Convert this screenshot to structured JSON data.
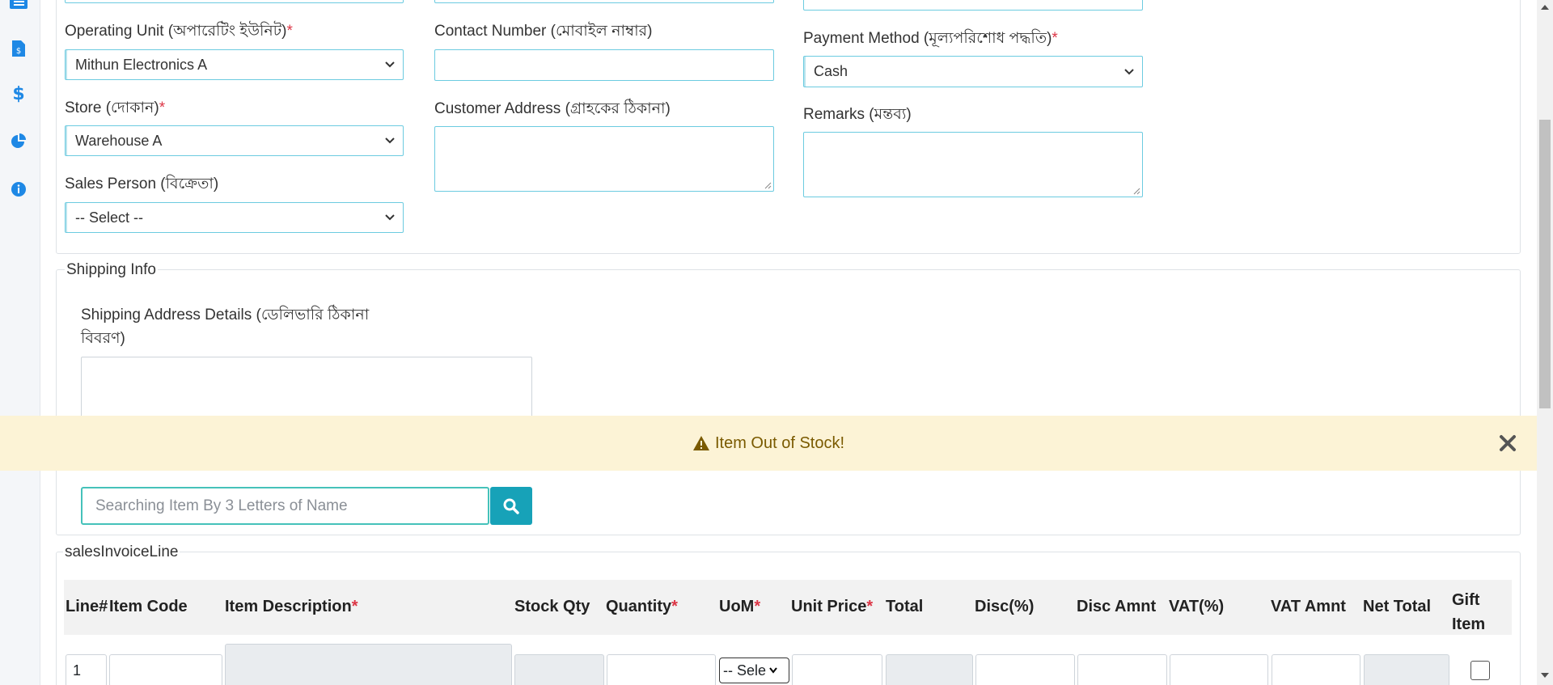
{
  "form": {
    "operating_unit_label": "Operating Unit (অপারেটিং ইউনিট)",
    "operating_unit_value": "Mithun Electronics A",
    "store_label": "Store (দোকান)",
    "store_value": "Warehouse A",
    "sales_person_label": "Sales Person (বিক্রেতা)",
    "sales_person_value": "-- Select --",
    "contact_number_label": "Contact Number (মোবাইল নাম্বার)",
    "contact_number_value": "",
    "customer_address_label": "Customer Address (গ্রাহকের ঠিকানা)",
    "customer_address_value": "",
    "payment_method_label": "Payment Method (মূল্যপরিশোধ পদ্ধতি)",
    "payment_method_value": "Cash",
    "remarks_label": "Remarks (মন্তব্য)",
    "remarks_value": "",
    "required_marker": "*"
  },
  "shipping": {
    "legend": "Shipping Info",
    "address_label_line1": "Shipping Address Details (ডেলিভারি ঠিকানা",
    "address_label_line2": "বিবরণ)"
  },
  "alert": {
    "message": "Item Out of Stock!",
    "icon": "warning-triangle-icon",
    "close_icon": "close-x-icon",
    "bg_color": "#fcf3d6",
    "text_color": "#7a5a00"
  },
  "search": {
    "placeholder": "Searching Item By 3 Letters of Name",
    "button_icon": "search-icon",
    "button_color": "#17a2b8"
  },
  "invoice_lines": {
    "legend": "salesInvoiceLine",
    "columns": [
      {
        "label": "Line#",
        "required": false
      },
      {
        "label": "Item Code",
        "required": false
      },
      {
        "label": "Item Description",
        "required": true
      },
      {
        "label": "Stock Qty",
        "required": false
      },
      {
        "label": "Quantity",
        "required": true
      },
      {
        "label": "UoM",
        "required": true
      },
      {
        "label": "Unit Price",
        "required": true
      },
      {
        "label": "Total",
        "required": false
      },
      {
        "label": "Disc(%)",
        "required": false
      },
      {
        "label": "Disc Amnt",
        "required": false
      },
      {
        "label": "VAT(%)",
        "required": false
      },
      {
        "label": "VAT Amnt",
        "required": false
      },
      {
        "label": "Net Total",
        "required": false
      },
      {
        "label": "Gift Item",
        "required": false
      }
    ],
    "row": {
      "line_no": "1",
      "uom_value": "-- Sele"
    }
  },
  "sidebar_icons": [
    "list-icon",
    "invoice-icon",
    "dollar-icon",
    "pie-chart-icon",
    "info-icon"
  ],
  "accent_color": "#1e88e5"
}
